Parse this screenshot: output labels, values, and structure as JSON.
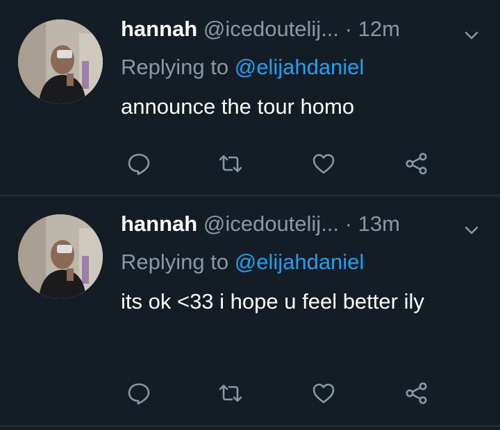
{
  "colors": {
    "background": "#141d26",
    "divider": "#26333f",
    "secondary_text": "#8899a6",
    "mention": "#1da1f2",
    "icon": "#8899a6"
  },
  "tweets": [
    {
      "name": "hannah",
      "handle": "@icedoutelij...",
      "separator": "·",
      "time": "12m",
      "replying_prefix": "Replying to",
      "replying_to": "@elijahdaniel",
      "text": "announce the tour homo",
      "icons": [
        "reply-icon",
        "retweet-icon",
        "like-icon",
        "share-icon"
      ]
    },
    {
      "name": "hannah",
      "handle": "@icedoutelij...",
      "separator": "·",
      "time": "13m",
      "replying_prefix": "Replying to",
      "replying_to": "@elijahdaniel",
      "text": "its ok <33 i hope u feel better ily",
      "icons": [
        "reply-icon",
        "retweet-icon",
        "like-icon",
        "share-icon"
      ]
    }
  ]
}
